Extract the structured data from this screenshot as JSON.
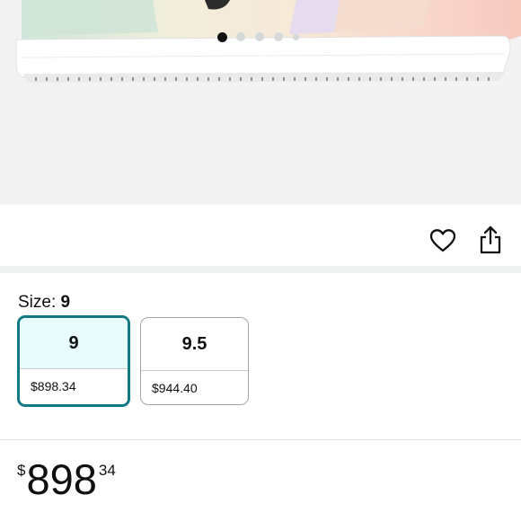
{
  "carousel": {
    "dot_count": 5,
    "active_index": 0
  },
  "size": {
    "label": "Size:",
    "selected": "9"
  },
  "size_options": [
    {
      "size": "9",
      "price": "$898.34",
      "selected": true
    },
    {
      "size": "9.5",
      "price": "$944.40",
      "selected": false
    }
  ],
  "price": {
    "currency": "$",
    "whole": "898",
    "fraction": "34"
  },
  "icons": {
    "wishlist": "heart-icon",
    "share": "share-icon"
  },
  "colors": {
    "selected_border": "#127a85",
    "selected_fill": "#e8fbfd",
    "divider": "#f0f2f2"
  }
}
